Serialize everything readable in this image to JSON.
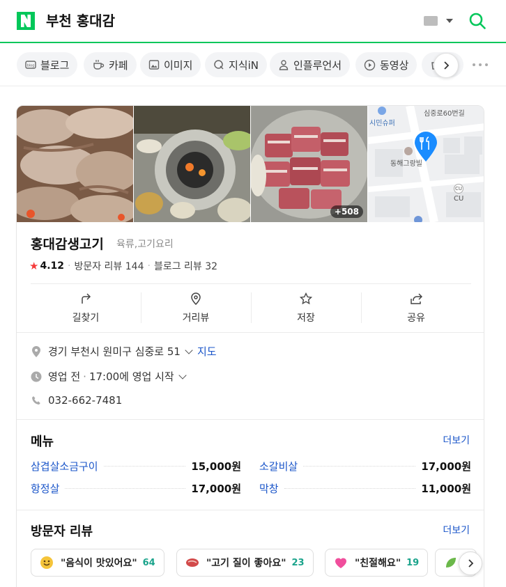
{
  "header": {
    "logo": "N",
    "query": "부천 홍대감"
  },
  "tabs": [
    {
      "label": "블로그",
      "icon": "blog-icon"
    },
    {
      "label": "카페",
      "icon": "cafe-cup-icon"
    },
    {
      "label": "이미지",
      "icon": "image-icon"
    },
    {
      "label": "지식iN",
      "icon": "kin-q-icon"
    },
    {
      "label": "인플루언서",
      "icon": "person-icon"
    },
    {
      "label": "동영상",
      "icon": "play-icon"
    },
    {
      "label": "",
      "icon": "shopping-icon"
    }
  ],
  "place": {
    "name": "홍대감생고기",
    "category": "육류,고기요리",
    "rating": "4.12",
    "visitor_reviews": "방문자 리뷰 144",
    "blog_reviews": "블로그 리뷰 32",
    "photo_count": "+508",
    "map_labels": {
      "street": "심중로60번길",
      "store": "시민슈퍼",
      "place": "동해그랑빌",
      "cu": "CU",
      "cu_badge": "CU"
    },
    "actions": [
      {
        "label": "길찾기",
        "icon": "directions-icon"
      },
      {
        "label": "거리뷰",
        "icon": "location-pin-icon"
      },
      {
        "label": "저장",
        "icon": "star-icon"
      },
      {
        "label": "공유",
        "icon": "share-icon"
      }
    ],
    "address": "경기 부천시 원미구 심중로 51",
    "map_link": "지도",
    "hours_status": "영업 전",
    "hours_detail": "17:00에 영업 시작",
    "phone": "032-662-7481"
  },
  "menu": {
    "title": "메뉴",
    "more": "더보기",
    "items": [
      {
        "name": "삼겹살소금구이",
        "price": "15,000원"
      },
      {
        "name": "소갈비살",
        "price": "17,000원"
      },
      {
        "name": "항정살",
        "price": "17,000원"
      },
      {
        "name": "막창",
        "price": "11,000원"
      }
    ]
  },
  "reviews": {
    "title": "방문자 리뷰",
    "more": "더보기",
    "keywords": [
      {
        "text": "\"음식이 맛있어요\"",
        "count": "64",
        "icon": "smile-emoji-icon"
      },
      {
        "text": "\"고기 질이 좋아요\"",
        "count": "23",
        "icon": "meat-emoji-icon"
      },
      {
        "text": "\"친절해요\"",
        "count": "19",
        "icon": "heart-emoji-icon"
      }
    ]
  },
  "colors": {
    "brand_green": "#03c75a",
    "link_blue": "#1a55c9",
    "rating_red": "#f53a3a",
    "count_teal": "#1aa38b"
  }
}
